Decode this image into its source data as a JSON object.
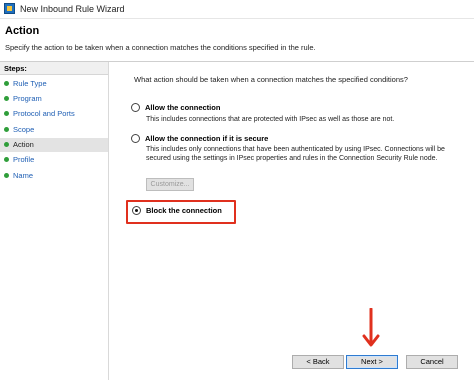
{
  "window": {
    "title": "New Inbound Rule Wizard",
    "icon": "firewall-wizard-icon"
  },
  "header": {
    "title": "Action",
    "description": "Specify the action to be taken when a connection matches the conditions specified in the rule."
  },
  "sidebar": {
    "steps_label": "Steps:",
    "items": [
      {
        "label": "Rule Type",
        "current": false
      },
      {
        "label": "Program",
        "current": false
      },
      {
        "label": "Protocol and Ports",
        "current": false
      },
      {
        "label": "Scope",
        "current": false
      },
      {
        "label": "Action",
        "current": true
      },
      {
        "label": "Profile",
        "current": false
      },
      {
        "label": "Name",
        "current": false
      }
    ]
  },
  "main": {
    "question": "What action should be taken when a connection matches the specified conditions?",
    "options": [
      {
        "label": "Allow the connection",
        "description": "This includes connections that are protected with IPsec as well as those are not.",
        "selected": false
      },
      {
        "label": "Allow the connection if it is secure",
        "description": "This includes only connections that have been authenticated by using IPsec.  Connections will be secured using the settings in IPsec properties and rules in the Connection Security Rule node.",
        "selected": false
      },
      {
        "label": "Block the connection",
        "description": "",
        "selected": true
      }
    ],
    "customize_label": "Customize...",
    "highlight_color": "#e0301e"
  },
  "buttons": {
    "back": "< Back",
    "next": "Next >",
    "cancel": "Cancel"
  },
  "colors": {
    "step_dot": "#2f9e3a",
    "step_link": "#1f5fb4",
    "annotation": "#e0301e"
  }
}
